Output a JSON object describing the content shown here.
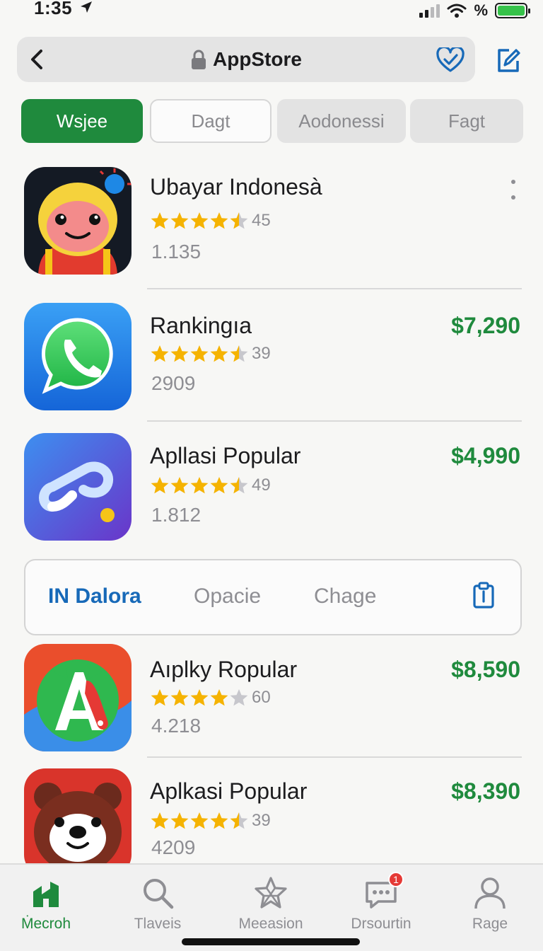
{
  "status_bar": {
    "time": "1:35",
    "battery_text": "%"
  },
  "nav": {
    "title": "AppStore"
  },
  "filters": [
    {
      "label": "Wsjee",
      "active": true
    },
    {
      "label": "Dagt",
      "active": false
    },
    {
      "label": "Aodonessi",
      "active": false
    },
    {
      "label": "Fagt",
      "active": false
    }
  ],
  "apps": [
    {
      "name": "Ubayar Indonesà",
      "rating": 4.5,
      "rating_count": "45",
      "installs": "1.135",
      "price": ""
    },
    {
      "name": "Rankingıa",
      "rating": 4.5,
      "rating_count": "39",
      "installs": "2909",
      "price": "$7,290"
    },
    {
      "name": "Apllasi Popular",
      "rating": 4.5,
      "rating_count": "49",
      "installs": "1.812",
      "price": "$4,990"
    },
    {
      "name": "Aıplky Ropular",
      "rating": 4.0,
      "rating_count": "60",
      "installs": "4.218",
      "price": "$8,590"
    },
    {
      "name": "Aplkasi Popular",
      "rating": 4.5,
      "rating_count": "39",
      "installs": "4209",
      "price": "$8,390"
    }
  ],
  "segment": {
    "items": [
      {
        "label": "IN Dalora",
        "active": true
      },
      {
        "label": "Opacie",
        "active": false
      },
      {
        "label": "Chage",
        "active": false
      }
    ]
  },
  "tabs": [
    {
      "label": "Ṁecroh",
      "icon": "home-icon",
      "active": true
    },
    {
      "label": "Tlaveis",
      "icon": "search-icon",
      "active": false
    },
    {
      "label": "Meeasion",
      "icon": "star-icon",
      "active": false
    },
    {
      "label": "Drsourtin",
      "icon": "chat-icon",
      "active": false,
      "badge": "1"
    },
    {
      "label": "Rage",
      "icon": "profile-icon",
      "active": false
    }
  ],
  "colors": {
    "accent_green": "#1f8a3d",
    "accent_blue": "#1769b8",
    "star": "#f5b301"
  }
}
